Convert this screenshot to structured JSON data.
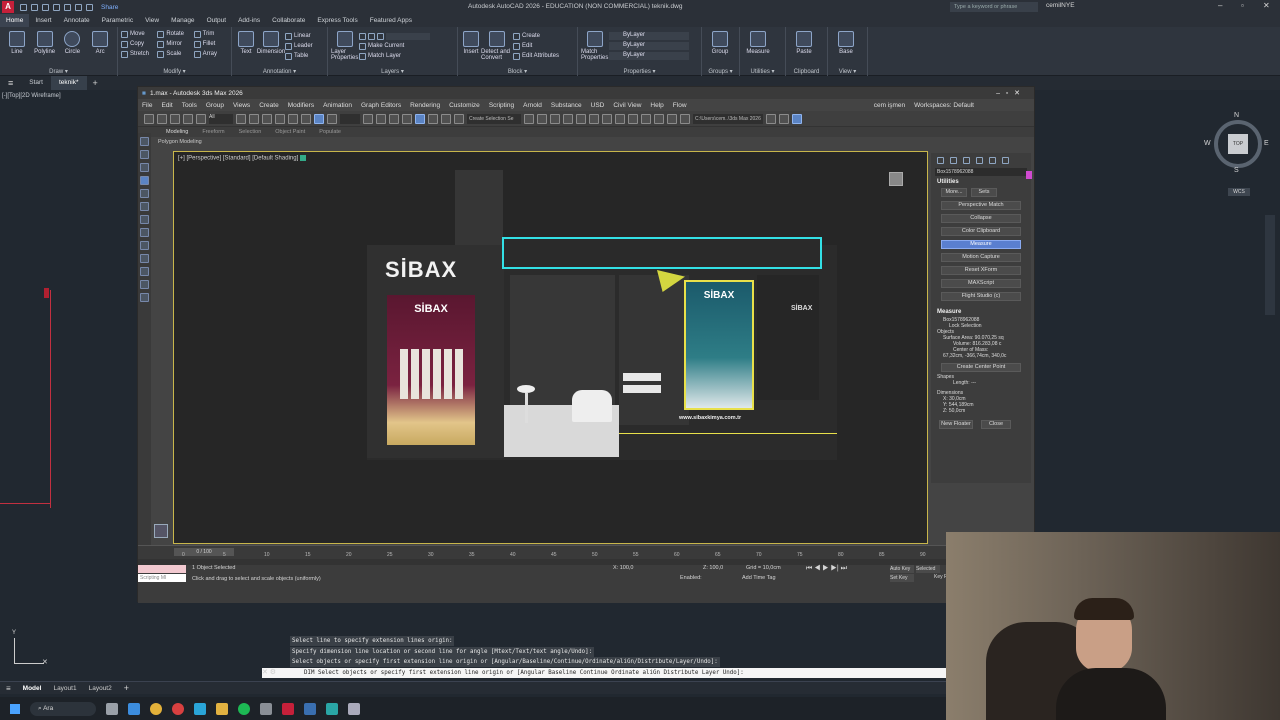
{
  "acad": {
    "title": "Autodesk AutoCAD 2026 - EDUCATION (NON COMMERCIAL)   teknik.dwg",
    "share_label": "Share",
    "search_placeholder": "Type a keyword or phrase",
    "user": "cemilNYE",
    "ribbon_tabs": [
      "Home",
      "Insert",
      "Annotate",
      "Parametric",
      "View",
      "Manage",
      "Output",
      "Add-ins",
      "Collaborate",
      "Express Tools",
      "Featured Apps"
    ],
    "panels": {
      "draw": {
        "label": "Draw ▾",
        "big": [
          "Line",
          "Polyline",
          "Circle",
          "Arc"
        ]
      },
      "modify": {
        "label": "Modify ▾",
        "items": [
          "Move",
          "Rotate",
          "Trim",
          "Copy",
          "Mirror",
          "Fillet",
          "Stretch",
          "Scale",
          "Array"
        ]
      },
      "annotation": {
        "label": "Annotation ▾",
        "big": [
          "Text",
          "Dimension"
        ],
        "items": [
          "Linear",
          "Leader",
          "Table"
        ]
      },
      "layers": {
        "label": "Layers ▾",
        "big": [
          "Layer Properties"
        ],
        "items": [
          "Make Current",
          "Match Layer"
        ]
      },
      "block": {
        "label": "Block ▾",
        "big": [
          "Insert"
        ],
        "items": [
          "Create",
          "Edit",
          "Edit Attributes"
        ],
        "extra": "Detect and Convert"
      },
      "properties": {
        "label": "Properties ▾",
        "big": [
          "Match Properties"
        ],
        "items": [
          "ByLayer",
          "ByLayer",
          "ByLayer"
        ]
      },
      "groups": {
        "label": "Groups ▾",
        "big": [
          "Group"
        ]
      },
      "utilities": {
        "label": "Utilities ▾",
        "big": [
          "Measure"
        ]
      },
      "clipboard": {
        "label": "Clipboard",
        "big": [
          "Paste"
        ]
      },
      "view": {
        "label": "View ▾",
        "big": [
          "Base"
        ]
      }
    },
    "file_tabs": [
      "Start",
      "teknik*"
    ],
    "viewport_label": "[-][Top][2D Wireframe]",
    "compass": {
      "n": "N",
      "s": "S",
      "e": "E",
      "w": "W",
      "top": "TOP",
      "wcs": "WCS"
    },
    "command_history": [
      "Select line to specify extension lines origin:",
      "Specify dimension line location or second line for angle [Mtext/Text/text angle/Undo]:",
      "Select objects or specify first extension line origin or [Angular/Baseline/Continue/Ordinate/aliGn/Distribute/Layer/Undo]:"
    ],
    "command_input": "DIM Select objects or specify first extension line origin or [Angular Baseline Continue Ordinate aliGn Distribute Layer Undo]:",
    "layout_tabs": [
      "Model",
      "Layout1",
      "Layout2"
    ],
    "taskbar_search": "Ara"
  },
  "max": {
    "title": "1.max - Autodesk 3ds Max 2026",
    "user": "cem işmen",
    "workspace": "Workspaces: Default",
    "menu": [
      "File",
      "Edit",
      "Tools",
      "Group",
      "Views",
      "Create",
      "Modifiers",
      "Animation",
      "Graph Editors",
      "Rendering",
      "Customize",
      "Scripting",
      "Arnold",
      "Substance",
      "USD",
      "Civil View",
      "Help",
      "Flow"
    ],
    "selection_set": "Create Selection Se",
    "path": "C:\\Users\\cem..\\3ds Max 2026",
    "ribbon_tabs": [
      "Modeling",
      "Freeform",
      "Selection",
      "Object Paint",
      "Populate"
    ],
    "ribbon_sub": "Polygon Modeling",
    "viewport_label": "[+] [Perspective] [Standard] [Default Shading]",
    "object_name": "Box1578962088",
    "utilities_label": "Utilities",
    "util_top": [
      "More...",
      "Sets"
    ],
    "util_buttons": [
      "Perspective Match",
      "Collapse",
      "Color Clipboard",
      "Measure",
      "Motion Capture",
      "Reset XForm",
      "MAXScript",
      "Flight Studio (c)"
    ],
    "measure_title": "Measure",
    "measure_obj": "Box1578962088",
    "lock_selection": "Lock Selection",
    "objects_label": "Objects",
    "surface_area": "Surface Area: 90.070,25 sq",
    "volume": "Volume: 816.283,08 c",
    "center_of_mass": "Center of Mass:",
    "com_value": "67,32cm, -366,74cm, 340,0c",
    "create_center_point": "Create Center Point",
    "shapes_label": "Shapes",
    "length": "Length: ---",
    "dimensions_label": "Dimensions",
    "dim_x": "X: 30,0cm",
    "dim_y": "Y: 544,189cm",
    "dim_z": "Z: 50,0cm",
    "new_floater": "New Floater",
    "close": "Close",
    "time_counter": "0 / 100",
    "ticks": [
      "0",
      "5",
      "10",
      "15",
      "20",
      "25",
      "30",
      "35",
      "40",
      "45",
      "50",
      "55",
      "60",
      "65",
      "70",
      "75",
      "80",
      "85",
      "90"
    ],
    "status_selected": "1 Object Selected",
    "status_hint": "Click and drag to select and scale objects (uniformly)",
    "script_box": "Scripting MI",
    "x_field": "X: 100,0",
    "z_field": "Z: 100,0",
    "grid": "Grid = 10,0cm",
    "enabled": "Enabled:",
    "add_time_tag": "Add Time Tag",
    "auto_key": "Auto Key",
    "set_key": "Set Key",
    "selected": "Selected",
    "key_filters": "Key Filters..."
  },
  "booth": {
    "logo": "SİBAX",
    "poster_logo": "SİBAX",
    "panel_logo": "SİBAX",
    "website": "www.sibaxkimya.com.tr",
    "side_logo": "SİBAX"
  }
}
